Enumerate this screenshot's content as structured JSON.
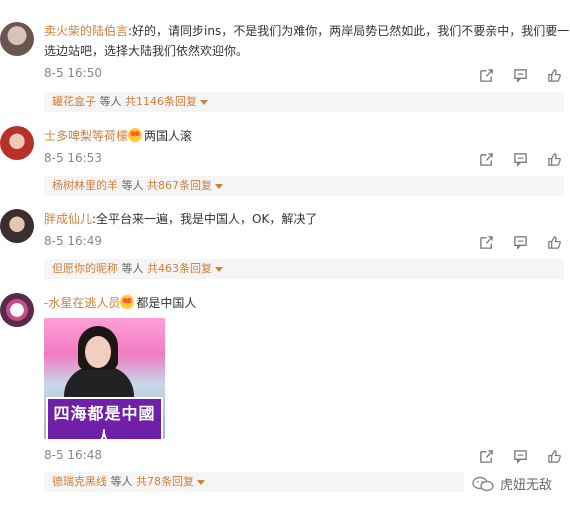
{
  "comments": [
    {
      "name": "卖火柴的陆伯言",
      "line1": ":好的，请同步ins，不是我们为难你，两岸局势已然如此，我们不要亲中，我们要一",
      "line2": "选边站吧，选择大陆我们依然欢迎你。",
      "time": "8-5 16:50",
      "reply_name": "罐花盒子",
      "reply_mid": " 等人 ",
      "reply_count": "共1146条回复"
    },
    {
      "name": "士多啤梨等荷檬",
      "line1": "两国人滚",
      "time": "8-5 16:53",
      "reply_name": "杨树林里的羊",
      "reply_mid": " 等人 ",
      "reply_count": "共867条回复"
    },
    {
      "name": "胖成仙儿",
      "line1": ":全平台来一遍，我是中国人，OK，解决了",
      "time": "8-5 16:49",
      "reply_name": "但愿你的昵称",
      "reply_mid": " 等人 ",
      "reply_count": "共463条回复"
    },
    {
      "name": "-水星在逃人员",
      "line1": "都是中国人",
      "time": "8-5 16:48",
      "reply_name": "德瑞克黑线",
      "reply_mid": " 等人 ",
      "reply_count": "共78条回复",
      "image_caption": "四海都是中國人"
    }
  ],
  "icons": [
    "share-icon",
    "comment-icon",
    "like-icon",
    "emoji-icon"
  ],
  "watermark": "虎妞无敌",
  "colors": {
    "name": "#d07f3d",
    "time": "#888888",
    "reply_bg": "#f5f5f5"
  }
}
